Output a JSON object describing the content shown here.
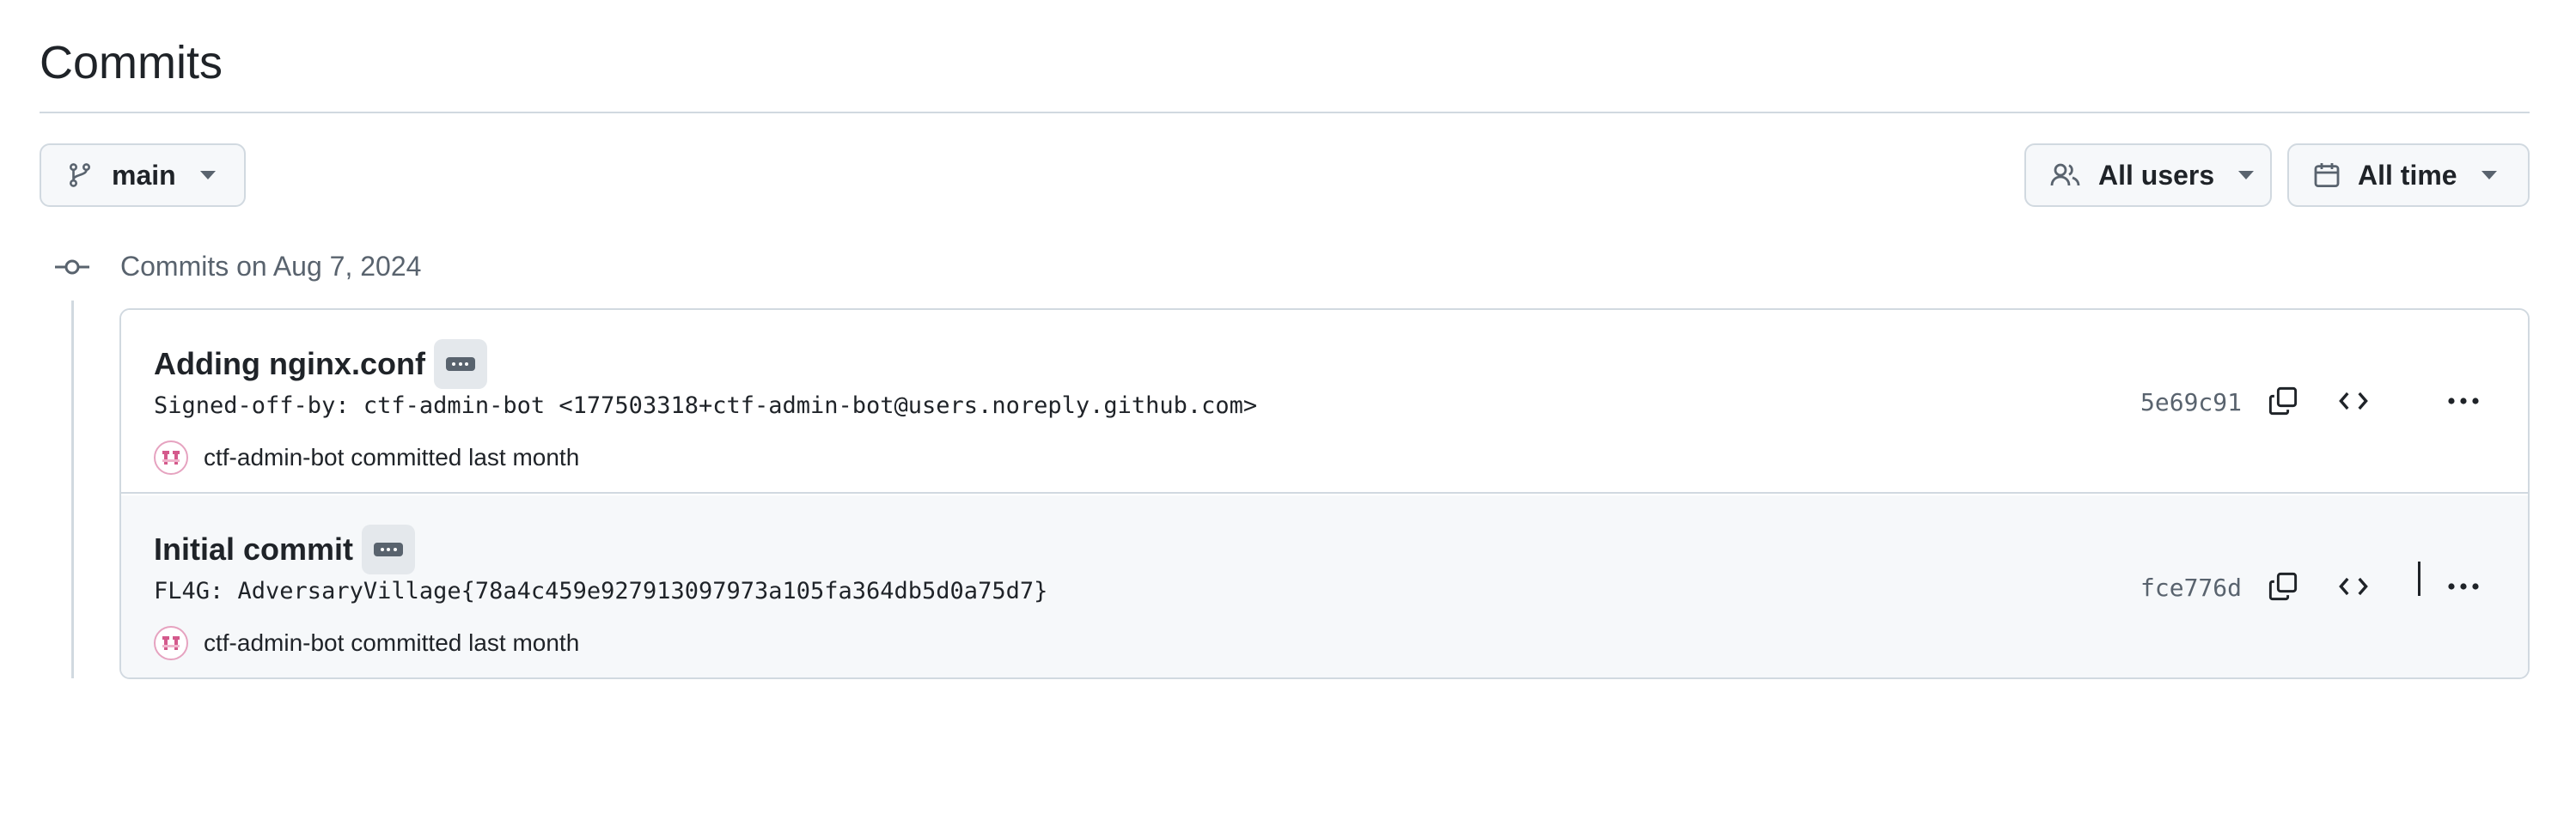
{
  "page": {
    "title": "Commits"
  },
  "toolbar": {
    "branch_label": "main",
    "users_label": "All users",
    "time_label": "All time"
  },
  "timeline": {
    "day_label": "Commits on Aug 7, 2024"
  },
  "commits": [
    {
      "title": "Adding nginx.conf",
      "body": "Signed-off-by: ctf-admin-bot <177503318+ctf-admin-bot@users.noreply.github.com>",
      "author": "ctf-admin-bot",
      "when": "committed last month",
      "sha": "5e69c91"
    },
    {
      "title": "Initial commit",
      "body": "FL4G: AdversaryVillage{78a4c459e927913097973a105fa364db5d0a75d7}",
      "author": "ctf-admin-bot",
      "when": "committed last month",
      "sha": "fce776d"
    }
  ],
  "icons": {
    "branch": "git-branch-icon",
    "users": "people-icon",
    "time": "calendar-icon",
    "timeline": "git-commit-icon",
    "expand": "ellipsis-icon",
    "copy": "copy-icon",
    "browse": "code-icon",
    "more": "kebab-horizontal-icon"
  },
  "colors": {
    "text": "#1f2328",
    "muted": "#59636e",
    "border": "#d1d9e0",
    "button_bg": "#f6f8fa",
    "avatar_accent": "#d45a8c"
  }
}
